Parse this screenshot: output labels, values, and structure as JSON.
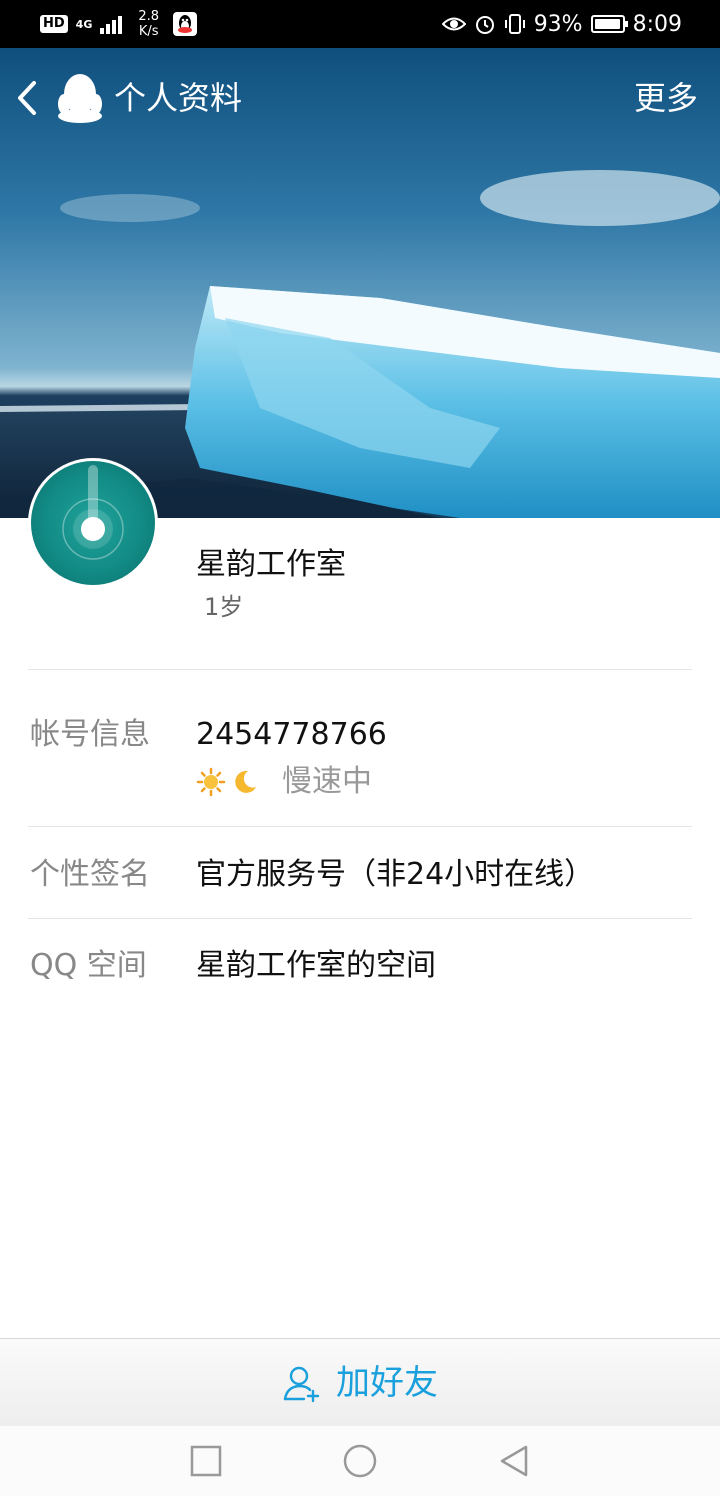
{
  "status_bar": {
    "hd": "HD",
    "network": "4G",
    "speed_value": "2.8",
    "speed_unit": "K/s",
    "battery": "93%",
    "time": "8:09"
  },
  "header": {
    "title": "个人资料",
    "more_label": "更多"
  },
  "profile": {
    "name": "星韵工作室",
    "age": "1岁"
  },
  "rows": [
    {
      "label": "帐号信息",
      "value": "2454778766",
      "status_text": "慢速中"
    },
    {
      "label": "个性签名",
      "value": "官方服务号（非24小时在线）"
    },
    {
      "label": "QQ 空间",
      "value": "星韵工作室的空间"
    }
  ],
  "action_bar": {
    "add_friend_label": "加好友"
  },
  "colors": {
    "accent": "#1aa0dc",
    "avatar": "#128b85",
    "label_gray": "#888888"
  },
  "icons": {
    "back": "chevron-left-icon",
    "logo": "qq-penguin-icon",
    "sun": "sun-icon",
    "moon": "moon-icon",
    "add_friend": "add-user-icon"
  }
}
